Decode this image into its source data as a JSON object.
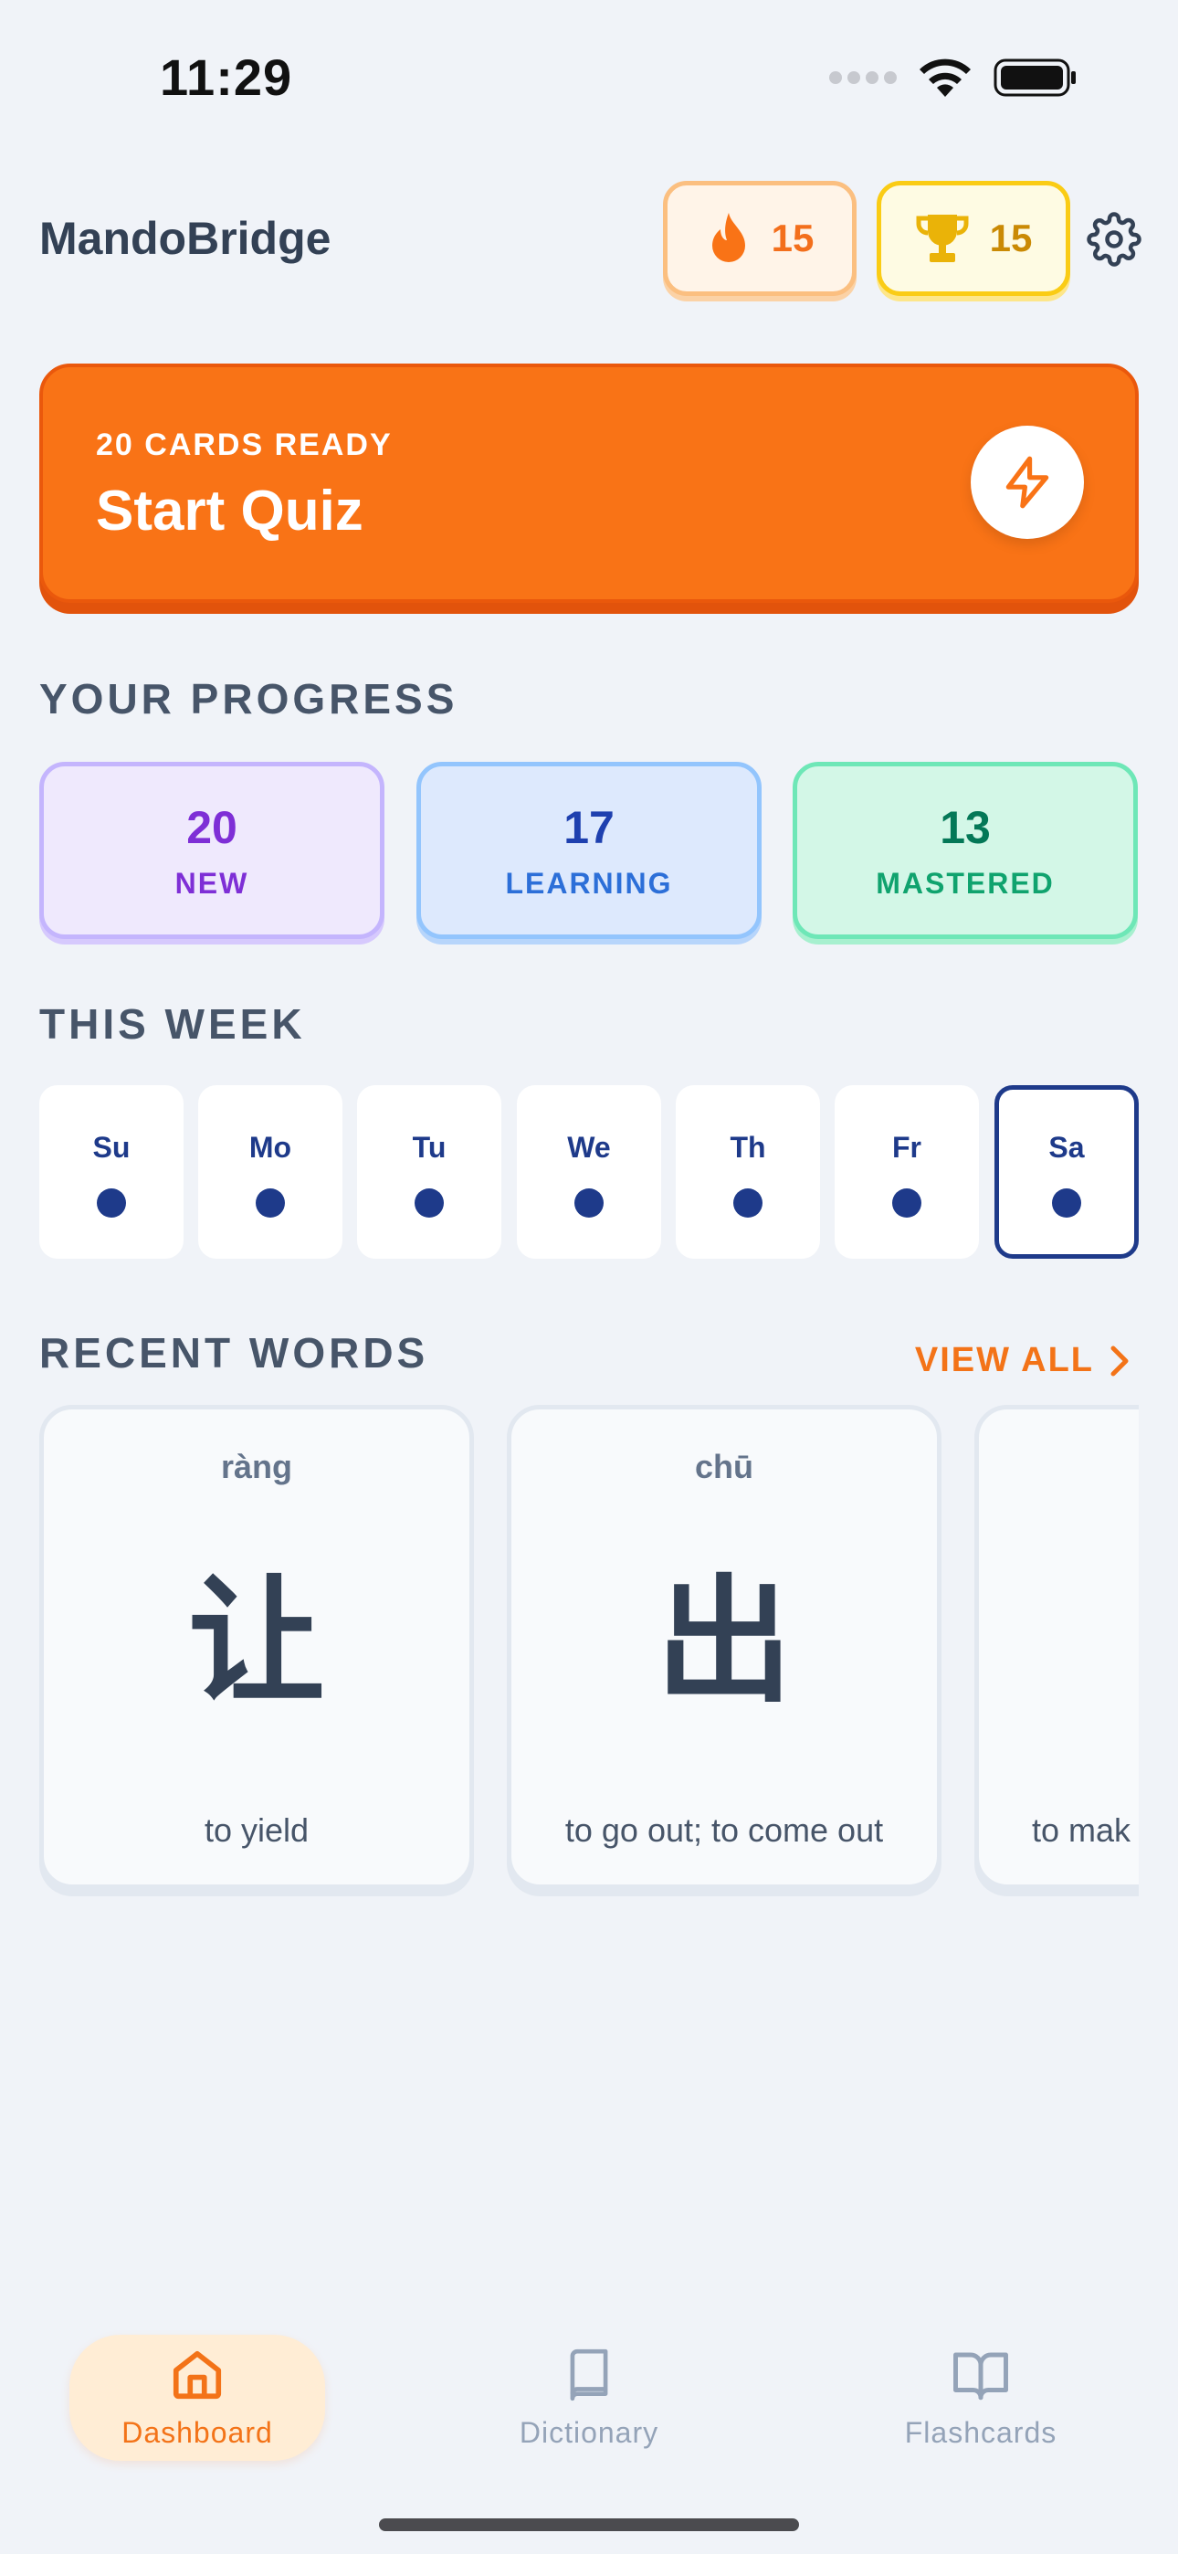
{
  "status_bar": {
    "time": "11:29"
  },
  "header": {
    "app_title": "MandoBridge",
    "streak": {
      "value": "15",
      "icon": "flame-icon"
    },
    "trophy": {
      "value": "15",
      "icon": "trophy-icon"
    },
    "settings_icon": "gear-icon"
  },
  "quiz": {
    "kicker": "20 CARDS READY",
    "title": "Start Quiz",
    "icon": "lightning-icon"
  },
  "progress": {
    "heading": "YOUR PROGRESS",
    "stats": [
      {
        "value": "20",
        "label": "NEW",
        "color": "#7e2fd6"
      },
      {
        "value": "17",
        "label": "LEARNING",
        "color": "#1e40af"
      },
      {
        "value": "13",
        "label": "MASTERED",
        "color": "#047857"
      }
    ]
  },
  "week": {
    "heading": "THIS WEEK",
    "days": [
      {
        "label": "Su",
        "active": true
      },
      {
        "label": "Mo",
        "active": true
      },
      {
        "label": "Tu",
        "active": true
      },
      {
        "label": "We",
        "active": true
      },
      {
        "label": "Th",
        "active": true
      },
      {
        "label": "Fr",
        "active": true
      },
      {
        "label": "Sa",
        "active": true,
        "today": true
      }
    ]
  },
  "recent_words": {
    "heading": "RECENT WORDS",
    "view_all": "VIEW ALL",
    "cards": [
      {
        "pinyin": "ràng",
        "hanzi": "让",
        "meaning": "to yield"
      },
      {
        "pinyin": "chū",
        "hanzi": "出",
        "meaning": "to go out; to come out"
      },
      {
        "pinyin": "",
        "hanzi": "",
        "meaning": "to mak"
      }
    ]
  },
  "bottom_nav": {
    "items": [
      {
        "label": "Dashboard",
        "icon": "home-icon",
        "active": true
      },
      {
        "label": "Dictionary",
        "icon": "book-icon",
        "active": false
      },
      {
        "label": "Flashcards",
        "icon": "open-book-icon",
        "active": false
      }
    ]
  },
  "colors": {
    "accent": "#f97316",
    "background": "#f0f3f8",
    "navy": "#1e3a8a"
  }
}
